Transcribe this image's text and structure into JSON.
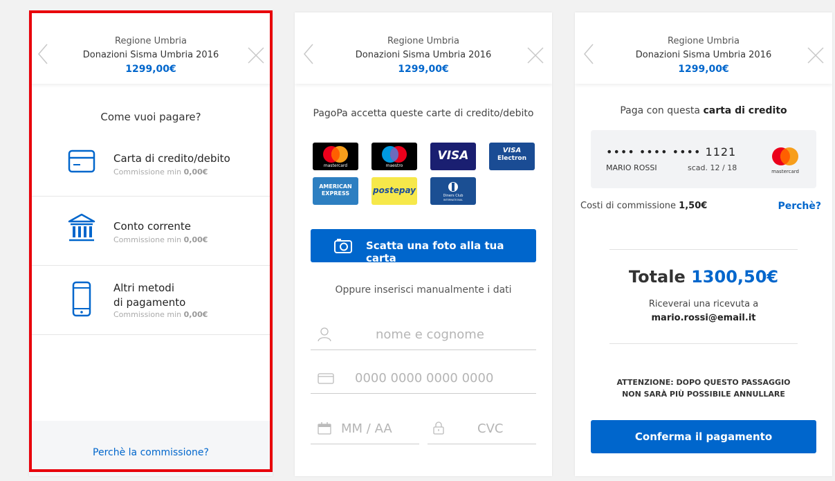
{
  "header": {
    "org": "Regione Umbria",
    "service": "Donazioni Sisma Umbria 2016",
    "amount": "1299,00€"
  },
  "screen1": {
    "question": "Come vuoi pagare?",
    "methods": [
      {
        "icon": "credit-card-icon",
        "title": "Carta di credito/debito",
        "commission_label": "Commissione min ",
        "commission_value": "0,00€"
      },
      {
        "icon": "bank-icon",
        "title": "Conto corrente",
        "commission_label": "Commissione min ",
        "commission_value": "0,00€"
      },
      {
        "icon": "smartphone-icon",
        "title_line1": "Altri metodi",
        "title_line2": "di pagamento",
        "commission_label": "Commissione min ",
        "commission_value": "0,00€"
      }
    ],
    "footer_link": "Perchè la commissione?"
  },
  "screen2": {
    "title": "PagoPa accetta queste carte di credito/debito",
    "cards": {
      "mastercard": "mastercard",
      "maestro": "maestro",
      "visa": "VISA",
      "visa_electron_top": "VISA",
      "visa_electron_bottom": "Electron",
      "amex_line1": "AMERICAN",
      "amex_line2": "EXPRESS",
      "postepay": "postepay",
      "diners_line1": "Diners Club",
      "diners_line2": "INTERNATIONAL"
    },
    "photo_button": "Scatta una foto alla tua carta",
    "or_text": "Oppure inserisci manualmente i dati",
    "name_placeholder": "nome e cognome",
    "card_placeholder": "0000 0000 0000 0000",
    "expiry_placeholder": "MM / AA",
    "cvc_placeholder": "CVC"
  },
  "screen3": {
    "title_prefix": "Paga con questa ",
    "title_bold": "carta di credito",
    "card_number": "•••• •••• ••••  1121",
    "card_holder": "MARIO ROSSI",
    "card_expiry": "scad. 12 / 18",
    "card_brand": "mastercard",
    "fee_label": "Costi di commissione ",
    "fee_value": "1,50€",
    "fee_why": "Perchè?",
    "total_label": "Totale ",
    "total_value": "1300,50€",
    "receipt_line1": "Riceverai una ricevuta a",
    "receipt_email": "mario.rossi@email.it",
    "warning_line1": "ATTENZIONE: DOPO QUESTO PASSAGGIO",
    "warning_line2": "NON SARÀ PIÙ POSSIBILE ANNULLARE",
    "confirm_button": "Conferma il pagamento"
  },
  "colors": {
    "accent": "#0066cc",
    "highlight": "#e8000b"
  }
}
